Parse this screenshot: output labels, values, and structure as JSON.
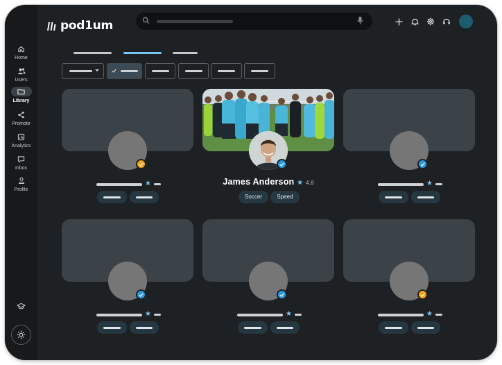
{
  "app": {
    "name": "pod1um"
  },
  "sidebar": {
    "items": [
      {
        "label": "Home",
        "icon": "home-icon"
      },
      {
        "label": "Users",
        "icon": "users-icon"
      },
      {
        "label": "Library",
        "icon": "folder-icon",
        "active": true
      },
      {
        "label": "Promote",
        "icon": "share-icon"
      },
      {
        "label": "Analytics",
        "icon": "analytics-icon"
      },
      {
        "label": "Inbox",
        "icon": "inbox-icon"
      },
      {
        "label": "Profile",
        "icon": "profile-icon"
      }
    ],
    "bottom_icons": [
      "graduation-cap-icon",
      "settings-sun-icon"
    ]
  },
  "header": {
    "search": {
      "icon": "search-icon",
      "mic_icon": "microphone-icon"
    },
    "actions": [
      "plus-icon",
      "bell-icon",
      "gear-icon",
      "support-headset-icon",
      "user-avatar"
    ]
  },
  "featured": {
    "name": "James Anderson",
    "star": "★",
    "rating": "4.8",
    "tags": [
      "Soccer",
      "Speed"
    ],
    "verified_color": "#2b9be0"
  },
  "colors": {
    "accent_tab": "#7cc4f5",
    "badge_blue": "#2b9be0",
    "badge_orange": "#f3a417",
    "background": "#1e2123"
  }
}
